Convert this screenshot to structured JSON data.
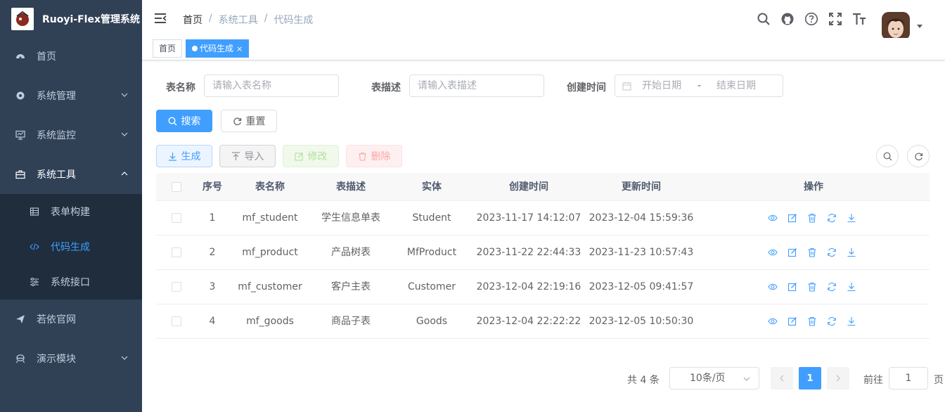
{
  "app": {
    "title": "Ruoyi-Flex管理系统"
  },
  "sidebar": {
    "items": [
      {
        "label": "首页",
        "icon": "dashboard-icon"
      },
      {
        "label": "系统管理",
        "icon": "gear-icon"
      },
      {
        "label": "系统监控",
        "icon": "monitor-icon"
      },
      {
        "label": "系统工具",
        "icon": "toolbox-icon"
      },
      {
        "label": "若依官网",
        "icon": "send-icon"
      },
      {
        "label": "演示模块",
        "icon": "demo-icon"
      }
    ],
    "subitems": [
      {
        "label": "表单构建",
        "icon": "form-icon"
      },
      {
        "label": "代码生成",
        "icon": "code-icon"
      },
      {
        "label": "系统接口",
        "icon": "api-icon"
      }
    ]
  },
  "navbar": {
    "breadcrumb": [
      "首页",
      "系统工具",
      "代码生成"
    ],
    "separator": "/"
  },
  "tags": [
    {
      "label": "首页",
      "active": false
    },
    {
      "label": "代码生成",
      "active": true,
      "close": "×"
    }
  ],
  "search": {
    "table_name_label": "表名称",
    "table_name_placeholder": "请输入表名称",
    "table_desc_label": "表描述",
    "table_desc_placeholder": "请输入表描述",
    "created_label": "创建时间",
    "start_placeholder": "开始日期",
    "range_sep": "-",
    "end_placeholder": "结束日期",
    "search_btn": "搜索",
    "reset_btn": "重置"
  },
  "toolbar": {
    "generate": "生成",
    "import": "导入",
    "edit": "修改",
    "delete": "删除"
  },
  "table": {
    "columns": [
      "序号",
      "表名称",
      "表描述",
      "实体",
      "创建时间",
      "更新时间",
      "操作"
    ],
    "rows": [
      {
        "index": "1",
        "name": "mf_student",
        "desc": "学生信息单表",
        "entity": "Student",
        "created": "2023-11-17 14:12:07",
        "updated": "2023-12-04 15:59:36"
      },
      {
        "index": "2",
        "name": "mf_product",
        "desc": "产品树表",
        "entity": "MfProduct",
        "created": "2023-11-22 22:44:33",
        "updated": "2023-11-23 10:57:43"
      },
      {
        "index": "3",
        "name": "mf_customer",
        "desc": "客户主表",
        "entity": "Customer",
        "created": "2023-12-04 22:19:16",
        "updated": "2023-12-05 09:41:57"
      },
      {
        "index": "4",
        "name": "mf_goods",
        "desc": "商品子表",
        "entity": "Goods",
        "created": "2023-12-04 22:22:22",
        "updated": "2023-12-05 10:50:30"
      }
    ]
  },
  "pagination": {
    "total": "共 4 条",
    "page_size": "10条/页",
    "current": "1",
    "goto_label": "前往",
    "goto_value": "1",
    "page_suffix": "页"
  },
  "colors": {
    "primary": "#409eff",
    "sidebar_bg": "#304156",
    "submenu_bg": "#1f2d3d"
  }
}
